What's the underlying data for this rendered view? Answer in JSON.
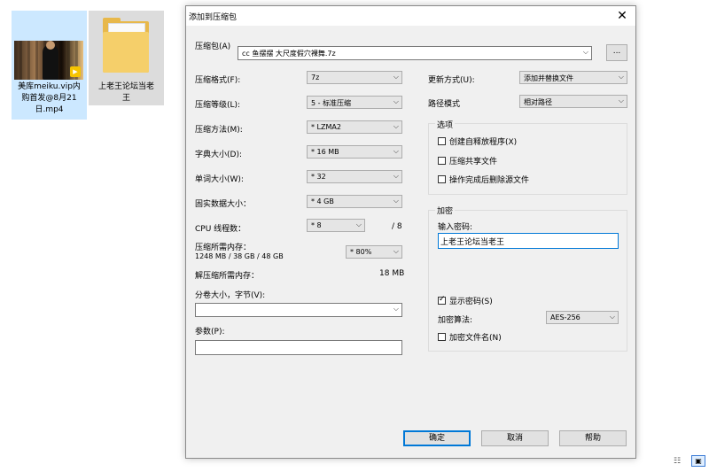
{
  "desktop": {
    "files": [
      {
        "name": "美库meiku.vip内购首发@8月21日.mp4",
        "lines": [
          "美库meiku.vip内",
          "购首发@8月21",
          "日.mp4"
        ],
        "badge": "Player"
      },
      {
        "name": "上老王论坛当老王",
        "lines": [
          "上老王论坛当老",
          "王"
        ]
      }
    ]
  },
  "dialog": {
    "title": "添加到压缩包",
    "archive_label": "压缩包(A)",
    "archive_value": "cc 鱼摆摆 大尺度假穴裸舞.7z",
    "browse_label": "...",
    "left": {
      "format_label": "压缩格式(F):",
      "format_value": "7z",
      "level_label": "压缩等级(L):",
      "level_value": "5 - 标准压缩",
      "method_label": "压缩方法(M):",
      "method_value": "* LZMA2",
      "dict_label": "字典大小(D):",
      "dict_value": "* 16 MB",
      "word_label": "单词大小(W):",
      "word_value": "* 32",
      "solid_label": "固实数据大小：",
      "solid_value": "* 4 GB",
      "cpu_label": "CPU 线程数：",
      "cpu_value": "* 8",
      "cpu_max": "/ 8",
      "mem_label": "压缩所需内存：",
      "mem_detail": "1248 MB / 38 GB / 48 GB",
      "mem_value": "* 80%",
      "decomp_label": "解压缩所需内存：",
      "decomp_value": "18 MB",
      "volume_label": "分卷大小，字节(V):",
      "volume_value": "",
      "params_label": "参数(P):",
      "params_value": ""
    },
    "right": {
      "update_label": "更新方式(U):",
      "update_value": "添加并替换文件",
      "path_label": "路径模式",
      "path_value": "相对路径",
      "options_title": "选项",
      "opt_sfx": "创建自释放程序(X)",
      "opt_shared": "压缩共享文件",
      "opt_delete": "操作完成后删除源文件",
      "encrypt_title": "加密",
      "password_label": "输入密码:",
      "password_value": "上老王论坛当老王",
      "show_pwd": "显示密码(S)",
      "method_label": "加密算法:",
      "method_value": "AES-256",
      "encrypt_names": "加密文件名(N)"
    },
    "buttons": {
      "ok": "确定",
      "cancel": "取消",
      "help": "帮助"
    }
  },
  "colors": {
    "selection": "#cce8ff",
    "default_button_border": "#0078d7",
    "folder": "#e8b84a"
  }
}
